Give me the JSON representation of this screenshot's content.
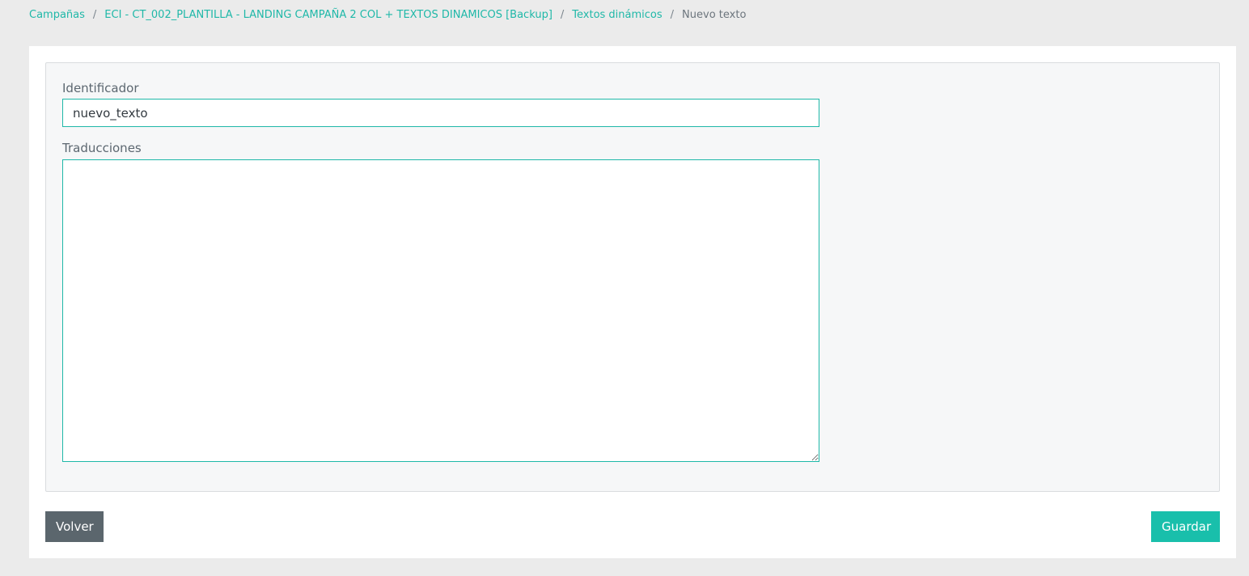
{
  "breadcrumb": {
    "items": [
      {
        "label": "Campañas"
      },
      {
        "label": "ECI - CT_002_PLANTILLA - LANDING CAMPAÑA 2 COL + TEXTOS DINAMICOS [Backup]"
      },
      {
        "label": "Textos dinámicos"
      }
    ],
    "separator": "/",
    "current": "Nuevo texto"
  },
  "form": {
    "identifier_label": "Identificador",
    "identifier_value": "nuevo_texto",
    "translations_label": "Traducciones",
    "translations_value": ""
  },
  "actions": {
    "back_label": "Volver",
    "save_label": "Guardar"
  },
  "colors": {
    "accent": "#1fb8a8",
    "save_button": "#19bfab",
    "back_button": "#5b666d",
    "page_background": "#ebebeb"
  }
}
